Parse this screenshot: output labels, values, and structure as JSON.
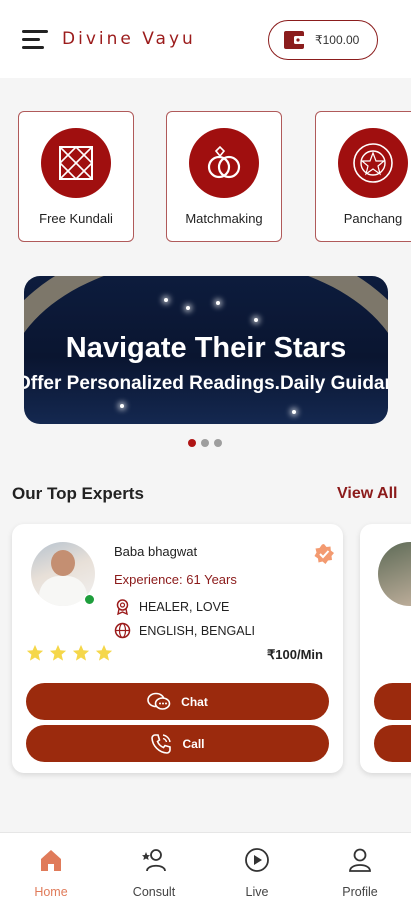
{
  "header": {
    "app_title": "Divine Vayu",
    "wallet_balance": "₹100.00"
  },
  "services": [
    {
      "label": "Free Kundali",
      "icon": "kundali-grid-icon"
    },
    {
      "label": "Matchmaking",
      "icon": "rings-icon"
    },
    {
      "label": "Panchang",
      "icon": "zodiac-wheel-icon"
    }
  ],
  "banner": {
    "title": "Navigate Their Stars",
    "subtitle": "Offer Personalized Readings.Daily Guidance"
  },
  "carousel": {
    "total": 3,
    "active": 1
  },
  "experts_section": {
    "title": "Our Top Experts",
    "view_all": "View All"
  },
  "experts": [
    {
      "name": "Baba bhagwat",
      "experience": "Experience: 61 Years",
      "specialties": "HEALER, LOVE",
      "languages": "ENGLISH, BENGALI",
      "price": "₹100/Min",
      "rating": 4,
      "online": true,
      "verified": true,
      "chat_label": "Chat",
      "call_label": "Call"
    }
  ],
  "bottom_nav": [
    {
      "label": "Home",
      "icon": "home-icon",
      "active": true
    },
    {
      "label": "Consult",
      "icon": "consult-icon",
      "active": false
    },
    {
      "label": "Live",
      "icon": "live-play-icon",
      "active": false
    },
    {
      "label": "Profile",
      "icon": "profile-icon",
      "active": false
    }
  ],
  "colors": {
    "brand": "#9b1b1b",
    "button": "#9b2a0d",
    "active_nav": "#e07b5a",
    "star": "#f5d74a",
    "online": "#1e9e3c"
  }
}
